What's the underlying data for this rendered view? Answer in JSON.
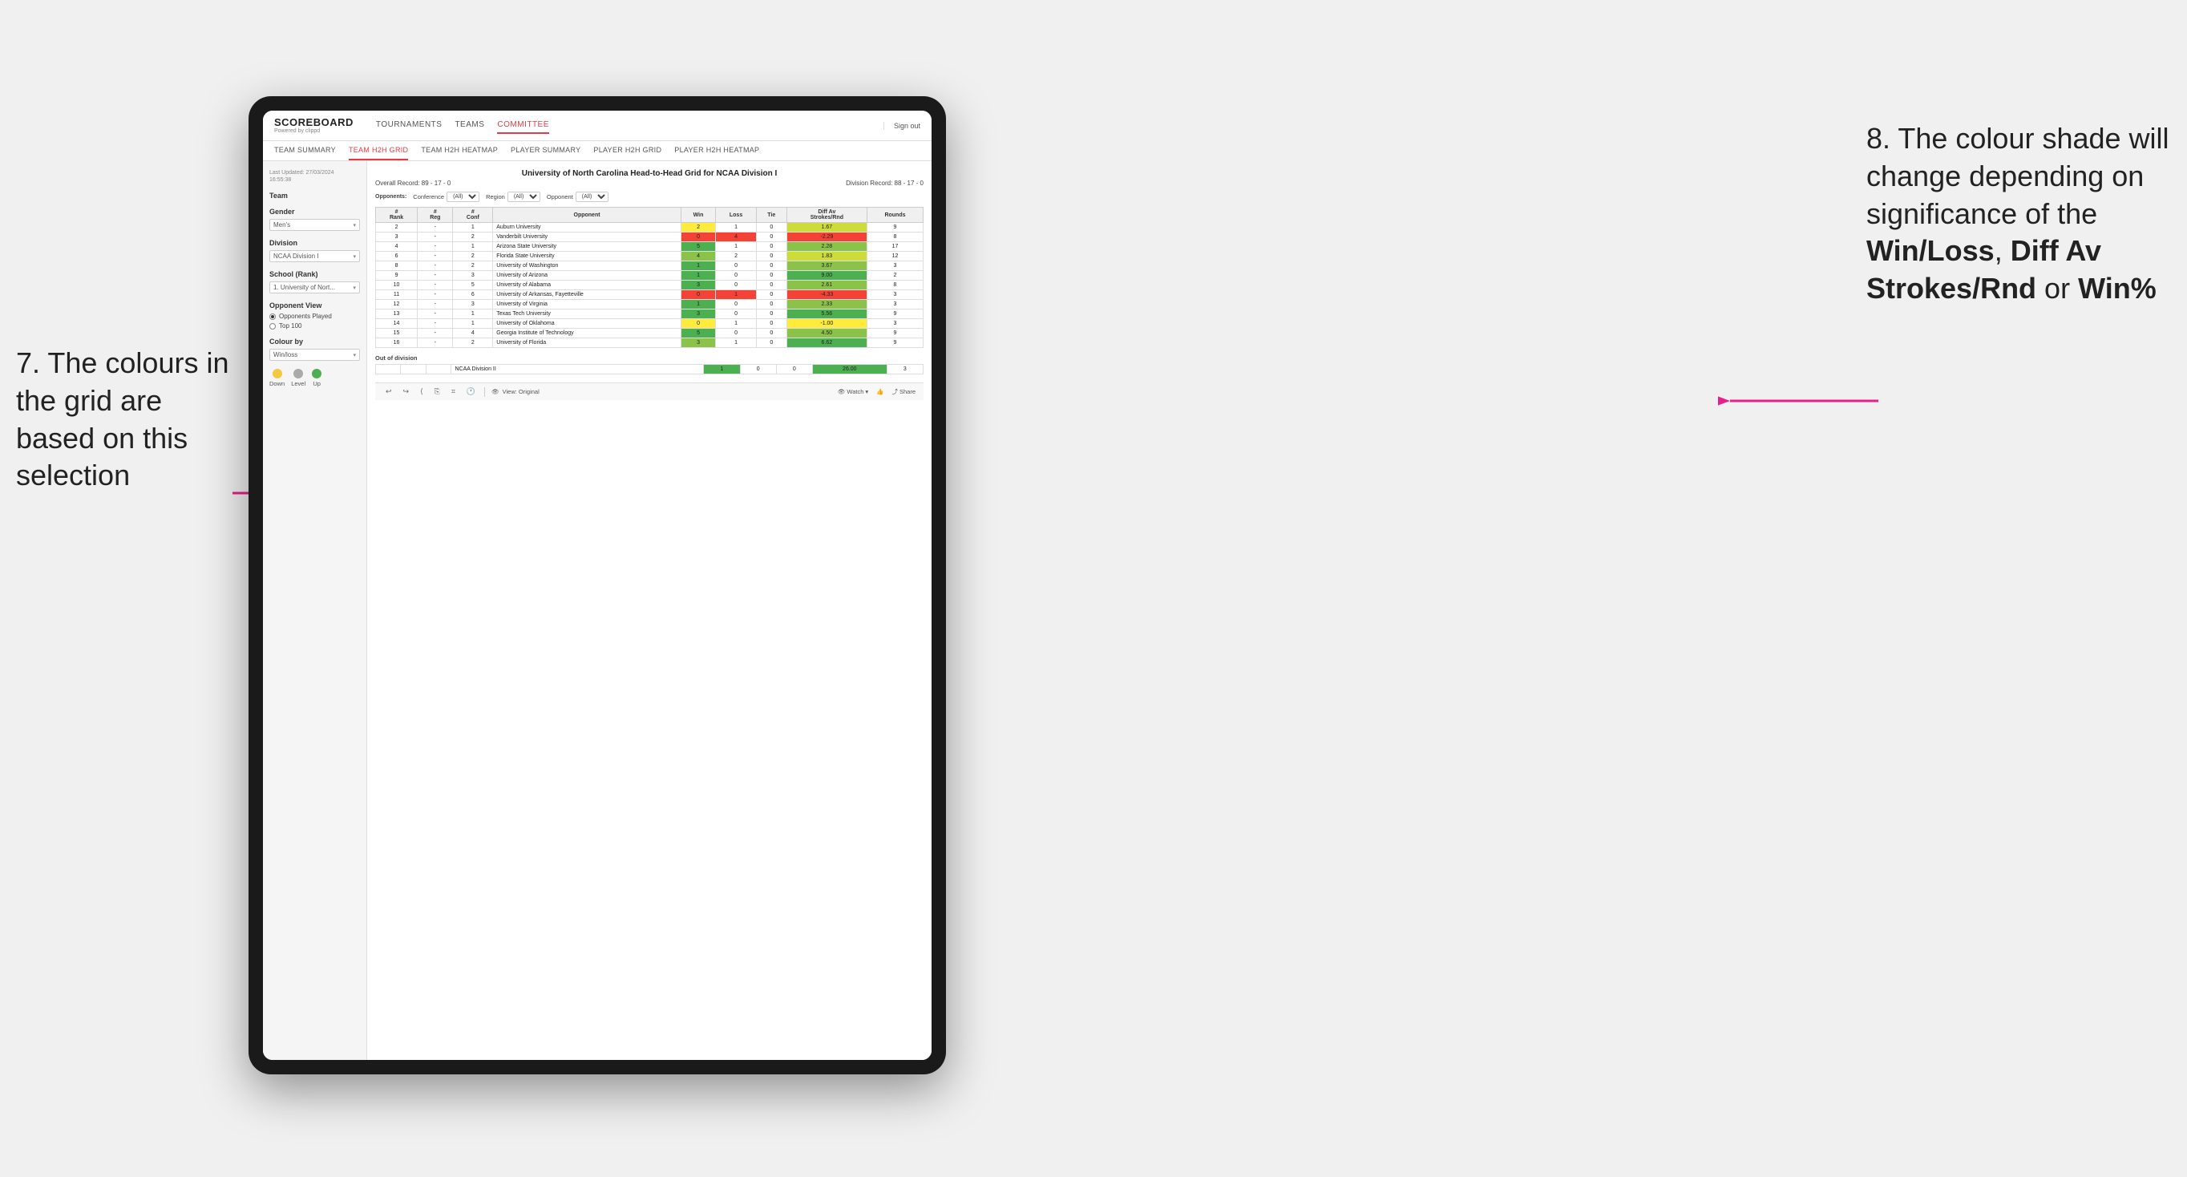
{
  "annotation_left": {
    "text": "7. The colours in the grid are based on this selection"
  },
  "annotation_right": {
    "prefix": "8. The colour shade will change depending on significance of the ",
    "bold1": "Win/Loss",
    "sep1": ", ",
    "bold2": "Diff Av Strokes/Rnd",
    "sep2": " or ",
    "bold3": "Win%"
  },
  "app": {
    "logo": "SCOREBOARD",
    "logo_sub": "Powered by clippd",
    "nav": [
      "TOURNAMENTS",
      "TEAMS",
      "COMMITTEE"
    ],
    "sign_out": "Sign out",
    "sub_nav": [
      "TEAM SUMMARY",
      "TEAM H2H GRID",
      "TEAM H2H HEATMAP",
      "PLAYER SUMMARY",
      "PLAYER H2H GRID",
      "PLAYER H2H HEATMAP"
    ]
  },
  "sidebar": {
    "last_updated_label": "Last Updated: 27/03/2024",
    "last_updated_time": "16:55:38",
    "team_label": "Team",
    "gender_label": "Gender",
    "gender_value": "Men's",
    "division_label": "Division",
    "division_value": "NCAA Division I",
    "school_label": "School (Rank)",
    "school_value": "1. University of Nort...",
    "opponent_view_label": "Opponent View",
    "radio_options": [
      "Opponents Played",
      "Top 100"
    ],
    "colour_by_label": "Colour by",
    "colour_by_value": "Win/loss",
    "legend": [
      {
        "color": "#f5c842",
        "label": "Down"
      },
      {
        "color": "#aaaaaa",
        "label": "Level"
      },
      {
        "color": "#4caf50",
        "label": "Up"
      }
    ]
  },
  "grid": {
    "title": "University of North Carolina Head-to-Head Grid for NCAA Division I",
    "overall_record": "Overall Record: 89 - 17 - 0",
    "division_record": "Division Record: 88 - 17 - 0",
    "filters": {
      "opponents_label": "Opponents:",
      "conference_label": "Conference",
      "conference_value": "(All)",
      "region_label": "Region",
      "region_value": "(All)",
      "opponent_label": "Opponent",
      "opponent_value": "(All)"
    },
    "columns": [
      "#\nRank",
      "# Reg",
      "# Conf",
      "Opponent",
      "Win",
      "Loss",
      "Tie",
      "Diff Av\nStrokes/Rnd",
      "Rounds"
    ],
    "rows": [
      {
        "rank": "2",
        "reg": "-",
        "conf": "1",
        "opponent": "Auburn University",
        "win": "2",
        "loss": "1",
        "tie": "0",
        "diff": "1.67",
        "rounds": "9",
        "win_color": "yellow",
        "diff_color": "green_light"
      },
      {
        "rank": "3",
        "reg": "-",
        "conf": "2",
        "opponent": "Vanderbilt University",
        "win": "0",
        "loss": "4",
        "tie": "0",
        "diff": "-2.29",
        "rounds": "8",
        "win_color": "red",
        "diff_color": "red"
      },
      {
        "rank": "4",
        "reg": "-",
        "conf": "1",
        "opponent": "Arizona State University",
        "win": "5",
        "loss": "1",
        "tie": "0",
        "diff": "2.28",
        "rounds": "17",
        "win_color": "green_dark",
        "diff_color": "green_mid"
      },
      {
        "rank": "6",
        "reg": "-",
        "conf": "2",
        "opponent": "Florida State University",
        "win": "4",
        "loss": "2",
        "tie": "0",
        "diff": "1.83",
        "rounds": "12",
        "win_color": "green_mid",
        "diff_color": "green_light"
      },
      {
        "rank": "8",
        "reg": "-",
        "conf": "2",
        "opponent": "University of Washington",
        "win": "1",
        "loss": "0",
        "tie": "0",
        "diff": "3.67",
        "rounds": "3",
        "win_color": "green_dark",
        "diff_color": "green_mid"
      },
      {
        "rank": "9",
        "reg": "-",
        "conf": "3",
        "opponent": "University of Arizona",
        "win": "1",
        "loss": "0",
        "tie": "0",
        "diff": "9.00",
        "rounds": "2",
        "win_color": "green_dark",
        "diff_color": "green_dark"
      },
      {
        "rank": "10",
        "reg": "-",
        "conf": "5",
        "opponent": "University of Alabama",
        "win": "3",
        "loss": "0",
        "tie": "0",
        "diff": "2.61",
        "rounds": "8",
        "win_color": "green_dark",
        "diff_color": "green_mid"
      },
      {
        "rank": "11",
        "reg": "-",
        "conf": "6",
        "opponent": "University of Arkansas, Fayetteville",
        "win": "0",
        "loss": "1",
        "tie": "0",
        "diff": "-4.33",
        "rounds": "3",
        "win_color": "red",
        "diff_color": "red"
      },
      {
        "rank": "12",
        "reg": "-",
        "conf": "3",
        "opponent": "University of Virginia",
        "win": "1",
        "loss": "0",
        "tie": "0",
        "diff": "2.33",
        "rounds": "3",
        "win_color": "green_dark",
        "diff_color": "green_mid"
      },
      {
        "rank": "13",
        "reg": "-",
        "conf": "1",
        "opponent": "Texas Tech University",
        "win": "3",
        "loss": "0",
        "tie": "0",
        "diff": "5.56",
        "rounds": "9",
        "win_color": "green_dark",
        "diff_color": "green_dark"
      },
      {
        "rank": "14",
        "reg": "-",
        "conf": "1",
        "opponent": "University of Oklahoma",
        "win": "0",
        "loss": "1",
        "tie": "0",
        "diff": "-1.00",
        "rounds": "3",
        "win_color": "yellow",
        "diff_color": "yellow"
      },
      {
        "rank": "15",
        "reg": "-",
        "conf": "4",
        "opponent": "Georgia Institute of Technology",
        "win": "5",
        "loss": "0",
        "tie": "0",
        "diff": "4.50",
        "rounds": "9",
        "win_color": "green_dark",
        "diff_color": "green_mid"
      },
      {
        "rank": "16",
        "reg": "-",
        "conf": "2",
        "opponent": "University of Florida",
        "win": "3",
        "loss": "1",
        "tie": "0",
        "diff": "6.62",
        "rounds": "9",
        "win_color": "green_mid",
        "diff_color": "green_dark"
      }
    ],
    "out_of_division_label": "Out of division",
    "out_of_division_row": {
      "name": "NCAA Division II",
      "win": "1",
      "loss": "0",
      "tie": "0",
      "diff": "26.00",
      "rounds": "3",
      "diff_color": "green_dark"
    }
  },
  "toolbar": {
    "view_label": "View: Original",
    "watch_label": "Watch",
    "share_label": "Share"
  }
}
